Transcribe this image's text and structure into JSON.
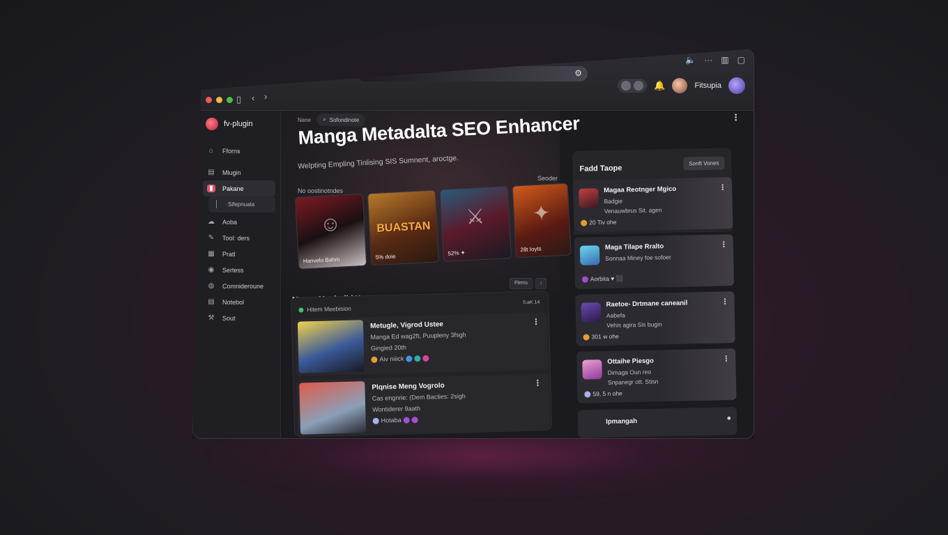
{
  "window": {
    "toolbar_icons": [
      "sidebar-icon",
      "chevron-left-icon",
      "chevron-right-icon",
      "settings-icon",
      "speaker-icon",
      "more-icon",
      "bookmark-icon",
      "window-icon",
      "bell-icon"
    ],
    "username": "Fitsupia"
  },
  "sidebar": {
    "brand": "fv-plugin",
    "items": [
      {
        "label": "Fforns",
        "icon": "home-icon"
      },
      {
        "label": "Mlugin",
        "icon": "plugin-icon"
      },
      {
        "label": "Pakane",
        "icon": "panel-icon"
      },
      {
        "label": "Sifepnuata",
        "icon": "sub-icon"
      },
      {
        "label": "Aoba",
        "icon": "cloud-icon"
      },
      {
        "label": "Tool: ders",
        "icon": "pen-icon"
      },
      {
        "label": "Pratl",
        "icon": "grid-icon"
      },
      {
        "label": "Sertess",
        "icon": "eye-icon"
      },
      {
        "label": "Comnideroune",
        "icon": "shield-icon"
      },
      {
        "label": "Notebol",
        "icon": "notebook-icon"
      },
      {
        "label": "Sout",
        "icon": "tool-icon"
      }
    ]
  },
  "main": {
    "crumb": "Nane",
    "search_placeholder": "Sofondinote",
    "title": "Manga Metadalta SEO Enhancer",
    "subtitle": "Welpting Empling Tinlising SIS Sumnent, aroctge.",
    "covers_label": "No oostinotndes",
    "covers_side_label": "Seoder",
    "covers": [
      {
        "caption": "Hanvelo Bahm"
      },
      {
        "caption": "5% doie",
        "art_text": "BUASTAN"
      },
      {
        "caption": "52% ✦"
      },
      {
        "caption": "28t Ioyts"
      }
    ],
    "section_title": "Manga Metdorlid Hyeng",
    "mini_buttons": [
      "Flems",
      "⁝"
    ],
    "list_head": "Hitem Meebision",
    "list_tag": "5:aK 14",
    "rows": [
      {
        "title": "Metugle, Vigrod Ustee",
        "line1": "Manga Ed wag2ft, Puupleny 3fsgh",
        "line2": "Gingied 20th",
        "line3": "Aiv niiick"
      },
      {
        "title": "Plqnise Meng Vogrolo",
        "line1": "Cas engnrie: (Dem Bacties: 2sigh",
        "line2": "Wontiderer 9aath",
        "line3": "Hotaba"
      }
    ]
  },
  "right_panel": {
    "title": "Fadd Taope",
    "button": "Sonft Vones",
    "cards": [
      {
        "title": "Magaa Reotnger Mgico",
        "line1": "Badgie",
        "line2": "Venauwbrus Sit. agen",
        "footer": "20 Tiv ohe"
      },
      {
        "title": "Maga Tilape Rralto",
        "line1": "Sonnaa Miney foe sofoer",
        "line2": "",
        "footer": "Aorbita ♥ ⬛"
      },
      {
        "title": "Raetoe- Drtmane caneanil",
        "line1": "Aabefa",
        "line2": "Vehis agira Sis bugin",
        "footer": "301 w ohe"
      },
      {
        "title": "Ottaihe Piesgo",
        "line1": "Dimaga Oun reo",
        "line2": "Snpanegr ott. Stisn",
        "footer": "59, 5 n ohe"
      }
    ],
    "bottom_item": "Ipmangah"
  }
}
